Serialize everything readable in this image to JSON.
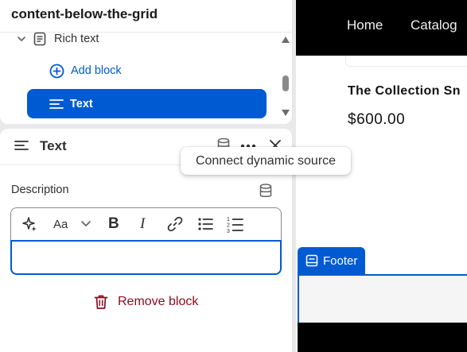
{
  "tree": {
    "title": "content-below-the-grid",
    "items": [
      {
        "label": "Rich text",
        "icon": "chevron-down-icon"
      },
      {
        "label": "Add block",
        "icon": "plus-circle-icon"
      },
      {
        "label": "Text",
        "icon": "text-align-icon",
        "selected": true
      }
    ]
  },
  "settings": {
    "title": "Text",
    "description_label": "Description",
    "description_value": "",
    "toolbar": [
      "magic-icon",
      "font-style-icon",
      "bold-icon",
      "italic-icon",
      "link-icon",
      "bullet-list-icon",
      "numbered-list-icon"
    ],
    "remove_label": "Remove block"
  },
  "tooltip": {
    "text": "Connect dynamic source"
  },
  "preview": {
    "nav": [
      "Home",
      "Catalog"
    ],
    "product_title": "The Collection Sn",
    "product_price": "$600.00",
    "footer_label": "Footer"
  },
  "colors": {
    "accent": "#005bd3",
    "danger": "#8e0b21",
    "text": "#303030"
  }
}
